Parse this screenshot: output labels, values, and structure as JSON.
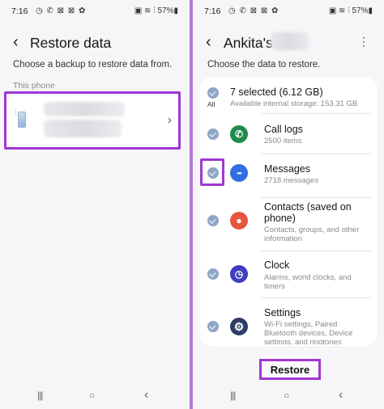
{
  "left": {
    "status": {
      "time": "7:16",
      "left_icons": "◷ ✆ ⊠ ⊠ ✿",
      "right_icons": "▣ ≋ ⫶ 57%▮"
    },
    "header": {
      "back": "‹",
      "title": "Restore data"
    },
    "subtitle": "Choose a backup to restore data from.",
    "section_label": "This phone",
    "backup_item": {
      "chevron": "›"
    },
    "nav": {
      "recents": "|||",
      "home": "○",
      "back": "‹"
    }
  },
  "right": {
    "status": {
      "time": "7:16",
      "left_icons": "◷ ✆ ⊠ ⊠ ✿",
      "right_icons": "▣ ≋ ⫶ 57%▮"
    },
    "header": {
      "back": "‹",
      "title": "Ankita's",
      "menu": "⋮"
    },
    "subtitle": "Choose the data to restore.",
    "summary": {
      "all_label": "All",
      "title": "7 selected (6.12 GB)",
      "sub": "Available internal storage: 153.31 GB"
    },
    "items": [
      {
        "icon": "phone-icon",
        "glyph": "✆",
        "color": "#1f8a4c",
        "title": "Call logs",
        "sub": "2500 items"
      },
      {
        "icon": "messages-icon",
        "glyph": "•••",
        "color": "#2f6fe0",
        "title": "Messages",
        "sub": "2718 messages"
      },
      {
        "icon": "contacts-icon",
        "glyph": "●",
        "color": "#e8553e",
        "title": "Contacts (saved on",
        "title2": "phone)",
        "sub": "Contacts, groups, and other",
        "sub2": "information"
      },
      {
        "icon": "clock-icon",
        "glyph": "◷",
        "color": "#3f3fbf",
        "title": "Clock",
        "sub": "Alarms, world clocks, and",
        "sub2": "timers"
      },
      {
        "icon": "settings-icon",
        "glyph": "⚙",
        "color": "#2c3e66",
        "title": "Settings",
        "sub": "Wi-Fi settings, Paired",
        "sub2": "Bluetooth devices, Device",
        "sub3": "settings, and ringtones"
      }
    ],
    "restore_label": "Restore",
    "nav": {
      "recents": "|||",
      "home": "○",
      "back": "‹"
    }
  }
}
